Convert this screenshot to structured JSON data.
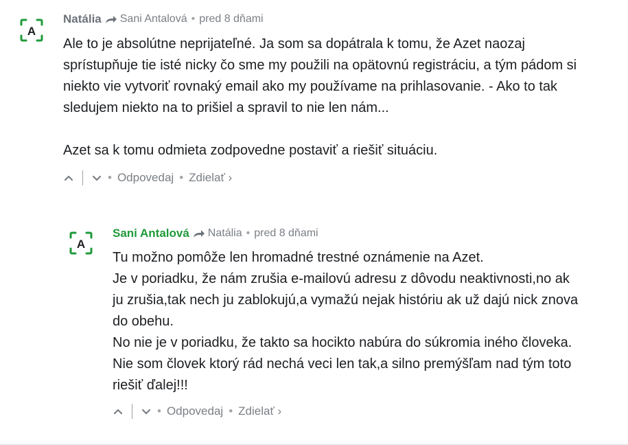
{
  "comments": [
    {
      "author": "Natália",
      "reply_to": "Sani Antalová",
      "time": "pred 8 dňami",
      "paragraphs": [
        "Ale to je absolútne neprijateľné. Ja som sa dopátrala k tomu, že Azet naozaj sprístupňuje tie isté nicky čo sme my použili na opätovnú registráciu, a tým pádom si niekto vie vytvoriť rovnaký email ako my používame na prihlasovanie. - Ako to tak sledujem niekto na to prišiel a spravil to nie len nám...",
        "Azet sa k tomu odmieta zodpovedne postaviť a riešiť situáciu."
      ],
      "reply_label": "Odpovedaj",
      "share_label": "Zdielať ›",
      "avatar_letter": "A"
    },
    {
      "author": "Sani Antalová",
      "reply_to": "Natália",
      "time": "pred 8 dňami",
      "lines": [
        "Tu možno pomôže len hromadné trestné oznámenie na Azet.",
        "Je v poriadku, že nám zrušia e-mailovú adresu z dôvodu neaktivnosti,no ak ju zrušia,tak nech ju zablokujú,a vymažú nejak históriu ak už dajú nick znova do obehu.",
        "No nie je v poriadku, že takto sa hocikto nabúra do súkromia iného človeka.",
        "Nie som človek ktorý rád nechá veci len tak,a silno premýšľam nad tým toto riešiť ďalej!!!"
      ],
      "reply_label": "Odpovedaj",
      "share_label": "Zdielať ›",
      "avatar_letter": "A"
    }
  ],
  "colors": {
    "brand_green": "#1f9a3a",
    "meta_gray": "#7a7f85"
  },
  "separator": "•"
}
